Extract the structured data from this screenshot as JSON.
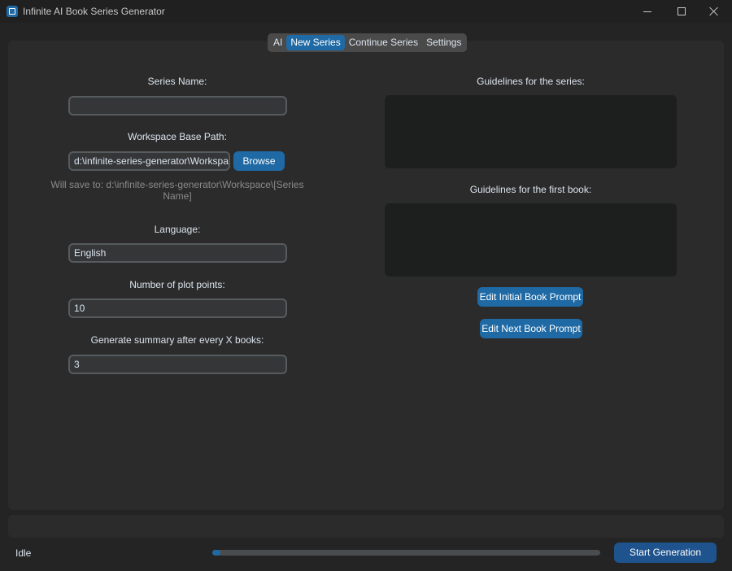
{
  "window": {
    "title": "Infinite AI Book Series Generator"
  },
  "tabs": [
    {
      "label": "AI",
      "active": false
    },
    {
      "label": "New Series",
      "active": true
    },
    {
      "label": "Continue Series",
      "active": false
    },
    {
      "label": "Settings",
      "active": false
    }
  ],
  "left": {
    "series_name_label": "Series Name:",
    "series_name_value": "",
    "workspace_label": "Workspace Base Path:",
    "workspace_value": "d:\\infinite-series-generator\\Workspa",
    "browse_label": "Browse",
    "save_hint_line1": "Will save to: d:\\infinite-series-generator\\Workspace\\[Series",
    "save_hint_line2": "Name]",
    "language_label": "Language:",
    "language_value": "English",
    "plot_points_label": "Number of plot points:",
    "plot_points_value": "10",
    "summary_label": "Generate summary after every X books:",
    "summary_value": "3"
  },
  "right": {
    "series_guidelines_label": "Guidelines for the series:",
    "first_book_guidelines_label": "Guidelines for the first book:",
    "edit_initial_label": "Edit Initial Book Prompt",
    "edit_next_label": "Edit Next Book Prompt"
  },
  "footer": {
    "status": "Idle",
    "progress": 0.02,
    "start_label": "Start Generation"
  },
  "colors": {
    "accent": "#1f6aa5",
    "background": "#242424",
    "panel": "#2b2b2b"
  }
}
